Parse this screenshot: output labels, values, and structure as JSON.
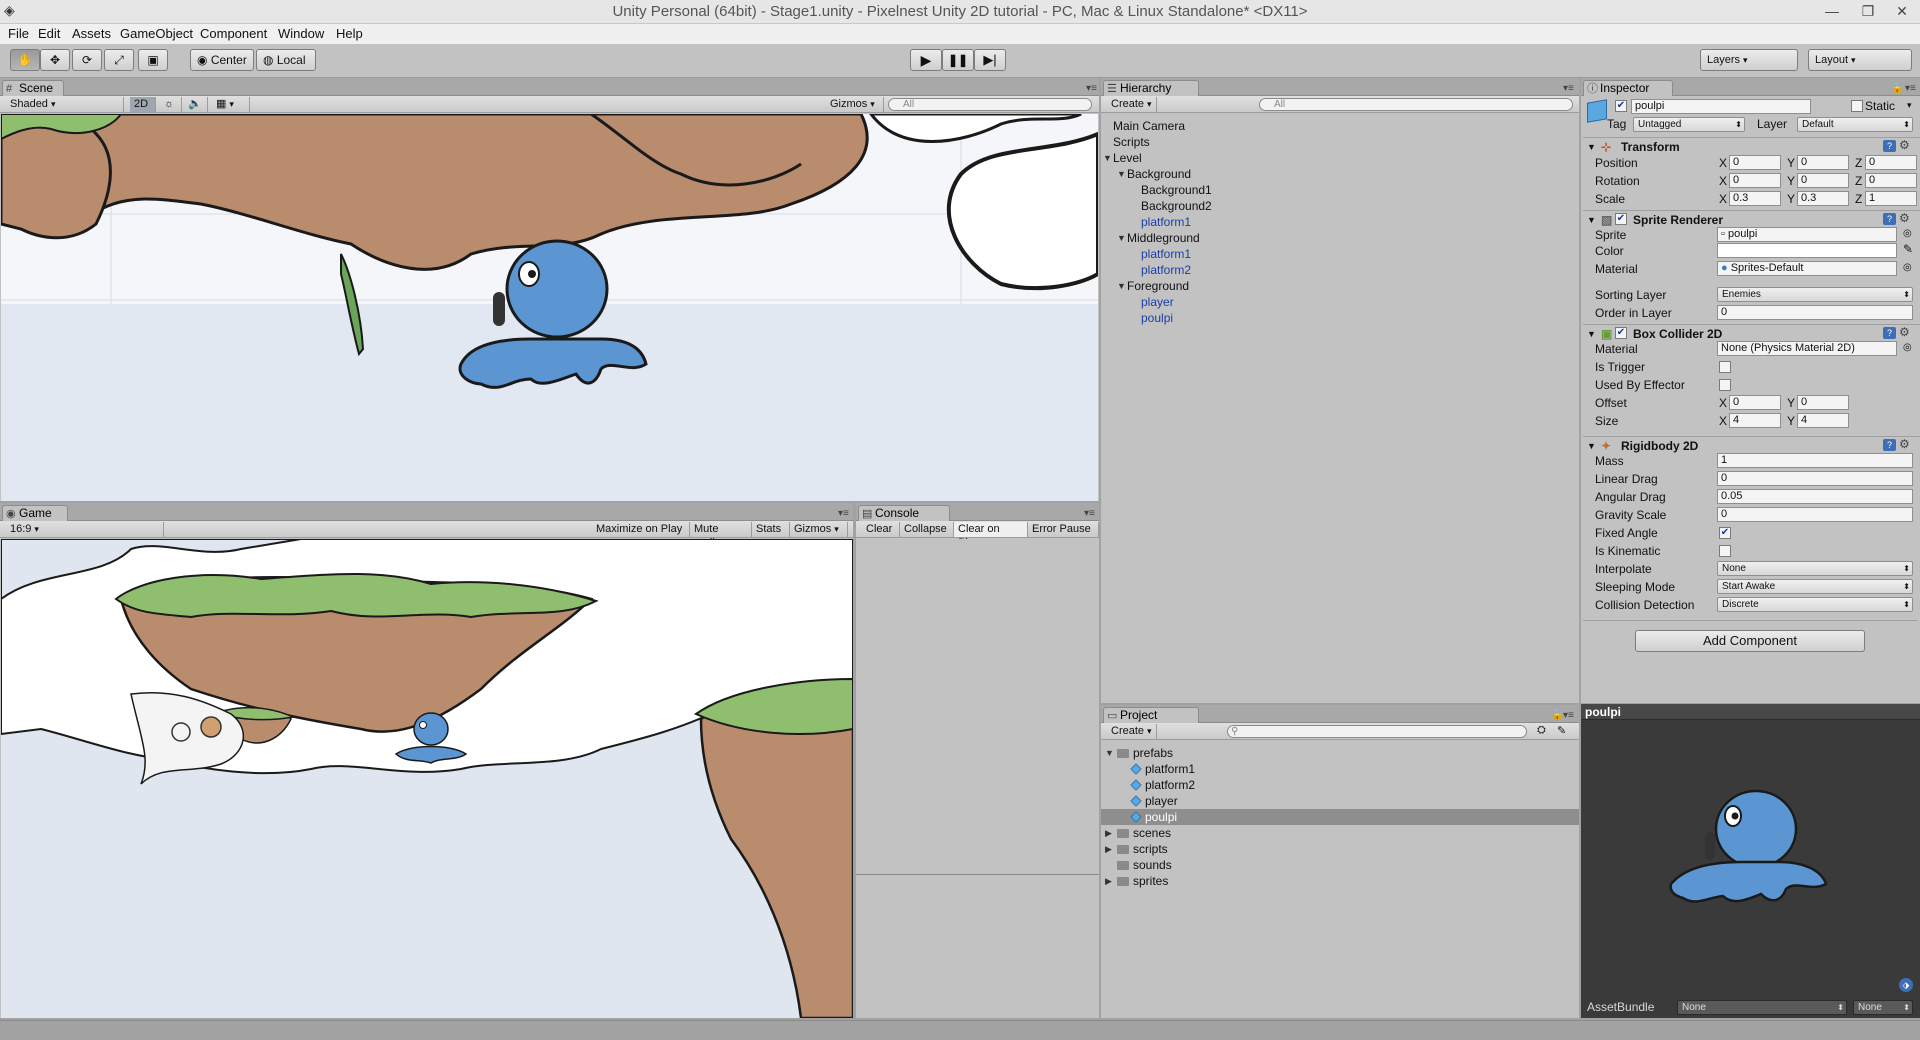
{
  "window": {
    "title": "Unity Personal (64bit) - Stage1.unity - Pixelnest Unity 2D tutorial - PC, Mac & Linux Standalone* <DX11>"
  },
  "menu": [
    "File",
    "Edit",
    "Assets",
    "GameObject",
    "Component",
    "Window",
    "Help"
  ],
  "toolbar": {
    "pivot_label": "Center",
    "space_label": "Local",
    "layers_label": "Layers",
    "layout_label": "Layout"
  },
  "scene": {
    "tab": "Scene",
    "shading": "Shaded",
    "mode_2d": "2D",
    "gizmos": "Gizmos",
    "search_placeholder": "All"
  },
  "game": {
    "tab": "Game",
    "aspect": "16:9",
    "buttons": [
      "Maximize on Play",
      "Mute audio",
      "Stats",
      "Gizmos"
    ]
  },
  "console": {
    "tab": "Console",
    "buttons": [
      "Clear",
      "Collapse",
      "Clear on Play",
      "Error Pause"
    ]
  },
  "hierarchy": {
    "tab": "Hierarchy",
    "create": "Create",
    "search_placeholder": "All",
    "items": [
      {
        "label": "Main Camera",
        "depth": 0,
        "arrow": "",
        "prefab": false
      },
      {
        "label": "Scripts",
        "depth": 0,
        "arrow": "",
        "prefab": false
      },
      {
        "label": "Level",
        "depth": 0,
        "arrow": "▼",
        "prefab": false
      },
      {
        "label": "Background",
        "depth": 1,
        "arrow": "▼",
        "prefab": false
      },
      {
        "label": "Background1",
        "depth": 2,
        "arrow": "",
        "prefab": false
      },
      {
        "label": "Background2",
        "depth": 2,
        "arrow": "",
        "prefab": false
      },
      {
        "label": "platform1",
        "depth": 2,
        "arrow": "",
        "prefab": true
      },
      {
        "label": "Middleground",
        "depth": 1,
        "arrow": "▼",
        "prefab": false
      },
      {
        "label": "platform1",
        "depth": 2,
        "arrow": "",
        "prefab": true
      },
      {
        "label": "platform2",
        "depth": 2,
        "arrow": "",
        "prefab": true
      },
      {
        "label": "Foreground",
        "depth": 1,
        "arrow": "▼",
        "prefab": false
      },
      {
        "label": "player",
        "depth": 2,
        "arrow": "",
        "prefab": true
      },
      {
        "label": "poulpi",
        "depth": 2,
        "arrow": "",
        "prefab": true
      }
    ]
  },
  "project": {
    "tab": "Project",
    "create": "Create",
    "items": [
      {
        "label": "prefabs",
        "depth": 0,
        "arrow": "▼",
        "kind": "folder",
        "selected": false
      },
      {
        "label": "platform1",
        "depth": 1,
        "arrow": "",
        "kind": "prefab",
        "selected": false
      },
      {
        "label": "platform2",
        "depth": 1,
        "arrow": "",
        "kind": "prefab",
        "selected": false
      },
      {
        "label": "player",
        "depth": 1,
        "arrow": "",
        "kind": "prefab",
        "selected": false
      },
      {
        "label": "poulpi",
        "depth": 1,
        "arrow": "",
        "kind": "prefab",
        "selected": true
      },
      {
        "label": "scenes",
        "depth": 0,
        "arrow": "▶",
        "kind": "folder",
        "selected": false
      },
      {
        "label": "scripts",
        "depth": 0,
        "arrow": "▶",
        "kind": "folder",
        "selected": false
      },
      {
        "label": "sounds",
        "depth": 0,
        "arrow": "",
        "kind": "folder",
        "selected": false
      },
      {
        "label": "sprites",
        "depth": 0,
        "arrow": "▶",
        "kind": "folder",
        "selected": false
      }
    ]
  },
  "inspector": {
    "tab": "Inspector",
    "name": "poulpi",
    "static_label": "Static",
    "tag_label": "Tag",
    "tag_value": "Untagged",
    "layer_label": "Layer",
    "layer_value": "Default",
    "transform": {
      "title": "Transform",
      "rows": [
        {
          "label": "Position",
          "x": "0",
          "y": "0",
          "z": "0"
        },
        {
          "label": "Rotation",
          "x": "0",
          "y": "0",
          "z": "0"
        },
        {
          "label": "Scale",
          "x": "0.3",
          "y": "0.3",
          "z": "1"
        }
      ]
    },
    "sprite_renderer": {
      "title": "Sprite Renderer",
      "sprite_label": "Sprite",
      "sprite_value": "poulpi",
      "color_label": "Color",
      "material_label": "Material",
      "material_value": "Sprites-Default",
      "sorting_label": "Sorting Layer",
      "sorting_value": "Enemies",
      "order_label": "Order in Layer",
      "order_value": "0"
    },
    "box_collider": {
      "title": "Box Collider 2D",
      "material_label": "Material",
      "material_value": "None (Physics Material 2D)",
      "trigger_label": "Is Trigger",
      "trigger": false,
      "effector_label": "Used By Effector",
      "effector": false,
      "offset_label": "Offset",
      "offset_x": "0",
      "offset_y": "0",
      "size_label": "Size",
      "size_x": "4",
      "size_y": "4"
    },
    "rigidbody": {
      "title": "Rigidbody 2D",
      "mass_label": "Mass",
      "mass": "1",
      "linear_label": "Linear Drag",
      "linear": "0",
      "angular_label": "Angular Drag",
      "angular": "0.05",
      "gravity_label": "Gravity Scale",
      "gravity": "0",
      "fixed_label": "Fixed Angle",
      "fixed": true,
      "kinematic_label": "Is Kinematic",
      "kinematic": false,
      "interpolate_label": "Interpolate",
      "interpolate": "None",
      "sleeping_label": "Sleeping Mode",
      "sleeping": "Start Awake",
      "collision_label": "Collision Detection",
      "collision": "Discrete"
    },
    "add_component": "Add Component",
    "preview_title": "poulpi",
    "assetbundle_label": "AssetBundle",
    "assetbundle_value": "None",
    "assetbundle_variant": "None"
  },
  "colors": {
    "sky": "#dfe6f0",
    "rock": "#b98c6e",
    "grass": "#8fbf6e",
    "octopus": "#5b96d2",
    "selection": "#8e8e8e"
  }
}
